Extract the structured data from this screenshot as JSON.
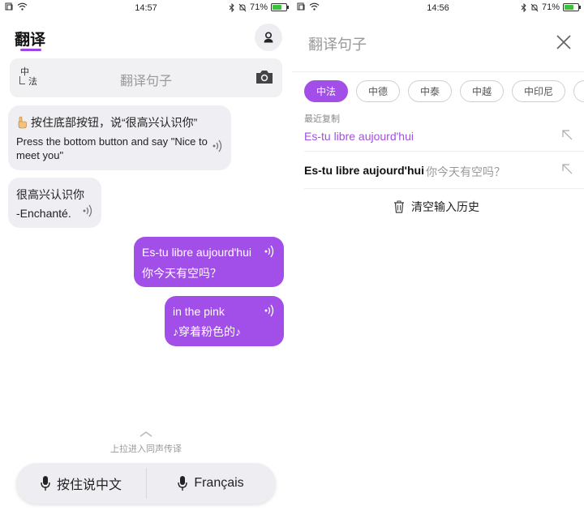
{
  "left": {
    "status": {
      "time": "14:57",
      "battery": "71%",
      "battery_level": 0.71
    },
    "header": {
      "title": "翻译"
    },
    "search": {
      "lang_top": "中",
      "lang_bottom": "法",
      "placeholder": "翻译句子"
    },
    "messages": [
      {
        "line1": "按住底部按钮，说“很高兴认识你”",
        "line2": "Press the bottom button and say \"Nice to meet you\""
      },
      {
        "source": "很高兴认识你",
        "translation": "-Enchanté."
      },
      {
        "source": "Es-tu libre aujourd'hui",
        "translation": "你今天有空吗？"
      },
      {
        "source": "in the pink",
        "translation": "♪穿着粉色的♪"
      }
    ],
    "pull_hint": "上拉进入同声传译",
    "mic": {
      "left_label": "按住说中文",
      "right_label": "Français"
    }
  },
  "right": {
    "status": {
      "time": "14:56",
      "battery": "71%",
      "battery_level": 0.71
    },
    "search": {
      "placeholder": "翻译句子"
    },
    "chips": [
      "中法",
      "中德",
      "中泰",
      "中越",
      "中印尼"
    ],
    "recent_label": "最近复制",
    "recent_copy": "Es-tu libre aujourd'hui",
    "history": [
      {
        "source": "Es-tu libre aujourd'hui",
        "translation": "你今天有空吗？"
      }
    ],
    "clear_label": "清空输入历史"
  },
  "colors": {
    "accent": "#a24ee8",
    "bubble_gray": "#efeef3",
    "battery_green": "#3cc13b"
  }
}
